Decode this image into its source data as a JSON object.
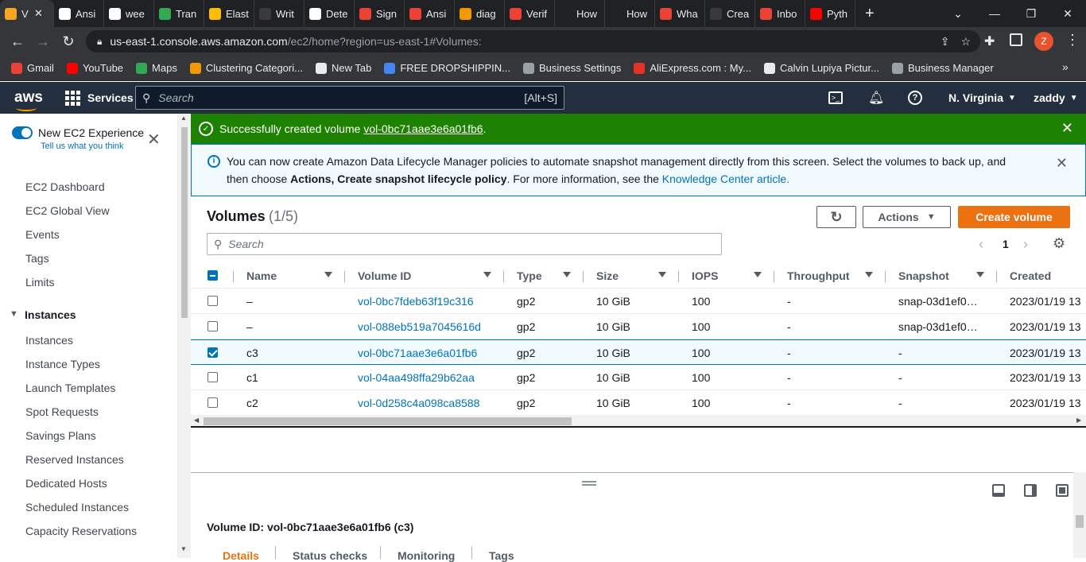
{
  "browser": {
    "tabs": [
      {
        "label": "V",
        "color": "#f5a623",
        "active": true
      },
      {
        "label": "Ansi",
        "color": "#ffffff"
      },
      {
        "label": "wee",
        "color": "#ffffff"
      },
      {
        "label": "Tran",
        "color": "#34a853"
      },
      {
        "label": "Elast",
        "color": "#fbbc04"
      },
      {
        "label": "Writ",
        "color": "#3a3a3a"
      },
      {
        "label": "Dete",
        "color": "#ffffff"
      },
      {
        "label": "Sign",
        "color": "#ea4335"
      },
      {
        "label": "Ansi",
        "color": "#ea4335"
      },
      {
        "label": "diag",
        "color": "#f29900"
      },
      {
        "label": "Verif",
        "color": "#ea4335"
      },
      {
        "label": "How",
        "color": "#202124"
      },
      {
        "label": "How",
        "color": "#202124"
      },
      {
        "label": "Wha",
        "color": "#ea4335"
      },
      {
        "label": "Crea",
        "color": "#3a3a3a"
      },
      {
        "label": "Inbo",
        "color": "#ea4335"
      },
      {
        "label": "Pyth",
        "color": "#ff0000"
      }
    ],
    "new_tab": "+",
    "url_host": "us-east-1.console.aws.amazon.com",
    "url_path": "/ec2/home?region=us-east-1#Volumes:",
    "profile_initial": "Z",
    "bookmarks": [
      {
        "label": "Gmail",
        "color": "#ea4335"
      },
      {
        "label": "YouTube",
        "color": "#ff0000"
      },
      {
        "label": "Maps",
        "color": "#34a853"
      },
      {
        "label": "Clustering Categori...",
        "color": "#f29900"
      },
      {
        "label": "New Tab",
        "color": "#e8eaed"
      },
      {
        "label": "FREE DROPSHIPPIN...",
        "color": "#4285f4"
      },
      {
        "label": "Business Settings",
        "color": "#9aa0a6"
      },
      {
        "label": "AliExpress.com : My...",
        "color": "#e43225"
      },
      {
        "label": "Calvin Lupiya Pictur...",
        "color": "#e8eaed"
      },
      {
        "label": "Business Manager",
        "color": "#9aa0a6"
      }
    ]
  },
  "aws": {
    "logo": "aws",
    "services": "Services",
    "search_placeholder": "Search",
    "search_shortcut": "[Alt+S]",
    "region": "N. Virginia",
    "user": "zaddy"
  },
  "sidebar": {
    "new_experience": "New EC2 Experience",
    "tell_us": "Tell us what you think",
    "items": [
      "EC2 Dashboard",
      "EC2 Global View",
      "Events",
      "Tags",
      "Limits"
    ],
    "section": "Instances",
    "section_items": [
      "Instances",
      "Instance Types",
      "Launch Templates",
      "Spot Requests",
      "Savings Plans",
      "Reserved Instances",
      "Dedicated Hosts",
      "Scheduled Instances",
      "Capacity Reservations"
    ]
  },
  "flash": {
    "success_prefix": "Successfully created volume ",
    "success_link": "vol-0bc71aae3e6a01fb6",
    "success_suffix": ".",
    "info_line1": "You can now create Amazon Data Lifecycle Manager policies to automate snapshot management directly from this screen. Select the volumes to back up, and",
    "info_then": "then choose ",
    "info_bold": "Actions, Create snapshot lifecycle policy",
    "info_mid": ". For more information, see the ",
    "info_link": "Knowledge Center article."
  },
  "volumes": {
    "title": "Volumes",
    "count": "(1/5)",
    "actions": "Actions",
    "create": "Create volume",
    "search_placeholder": "Search",
    "page": "1",
    "columns": [
      "Name",
      "Volume ID",
      "Type",
      "Size",
      "IOPS",
      "Throughput",
      "Snapshot",
      "Created"
    ],
    "rows": [
      {
        "name": "–",
        "id": "vol-0bc7fdeb63f19c316",
        "type": "gp2",
        "size": "10 GiB",
        "iops": "100",
        "throughput": "-",
        "snapshot": "snap-03d1ef0…",
        "created": "2023/01/19 13",
        "selected": false
      },
      {
        "name": "–",
        "id": "vol-088eb519a7045616d",
        "type": "gp2",
        "size": "10 GiB",
        "iops": "100",
        "throughput": "-",
        "snapshot": "snap-03d1ef0…",
        "created": "2023/01/19 13",
        "selected": false
      },
      {
        "name": "c3",
        "id": "vol-0bc71aae3e6a01fb6",
        "type": "gp2",
        "size": "10 GiB",
        "iops": "100",
        "throughput": "-",
        "snapshot": "-",
        "created": "2023/01/19 13",
        "selected": true
      },
      {
        "name": "c1",
        "id": "vol-04aa498ffa29b62aa",
        "type": "gp2",
        "size": "10 GiB",
        "iops": "100",
        "throughput": "-",
        "snapshot": "-",
        "created": "2023/01/19 13",
        "selected": false
      },
      {
        "name": "c2",
        "id": "vol-0d258c4a098ca8588",
        "type": "gp2",
        "size": "10 GiB",
        "iops": "100",
        "throughput": "-",
        "snapshot": "-",
        "created": "2023/01/19 13",
        "selected": false
      }
    ]
  },
  "details": {
    "heading": "Volume ID: vol-0bc71aae3e6a01fb6 (c3)",
    "tabs": [
      "Details",
      "Status checks",
      "Monitoring",
      "Tags"
    ]
  }
}
